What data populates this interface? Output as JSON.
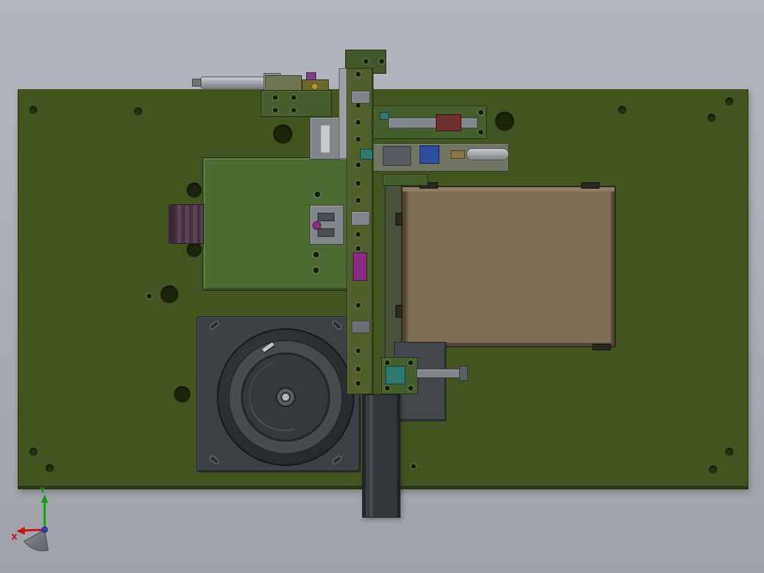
{
  "triad": {
    "x_label": "X",
    "y_label": "Y",
    "x_color": "#cc1111",
    "y_color": "#0aa40a",
    "z_color": "#2244cc"
  },
  "palette": {
    "bg_top": "#b3b7bd",
    "bg_bottom": "#9fa3a9",
    "baseplate": "#42551f",
    "baseplate_edge": "#243208",
    "green_box": "#4d6a31",
    "conveyor": "#7d6e55",
    "feeder_plate": "#3d4145",
    "bowl_ring": "#2a2d30",
    "belt": "#383c40",
    "actuator_purple": "#5c4154",
    "column_green": "#50602a",
    "magenta_part": "#8a2f86",
    "teal_part": "#2e7a70",
    "blue_part": "#2e4f9e",
    "maroon_part": "#6e3030",
    "steel": "#9ba0a4"
  },
  "parts": [
    "machine-baseplate",
    "vibratory-bowl-feeder",
    "conveyor-platform",
    "green-equipment-box",
    "purple-actuator",
    "pneumatic-cylinder",
    "linear-tool-column",
    "discharge-belt",
    "gripper-assembly",
    "orientation-triad"
  ]
}
